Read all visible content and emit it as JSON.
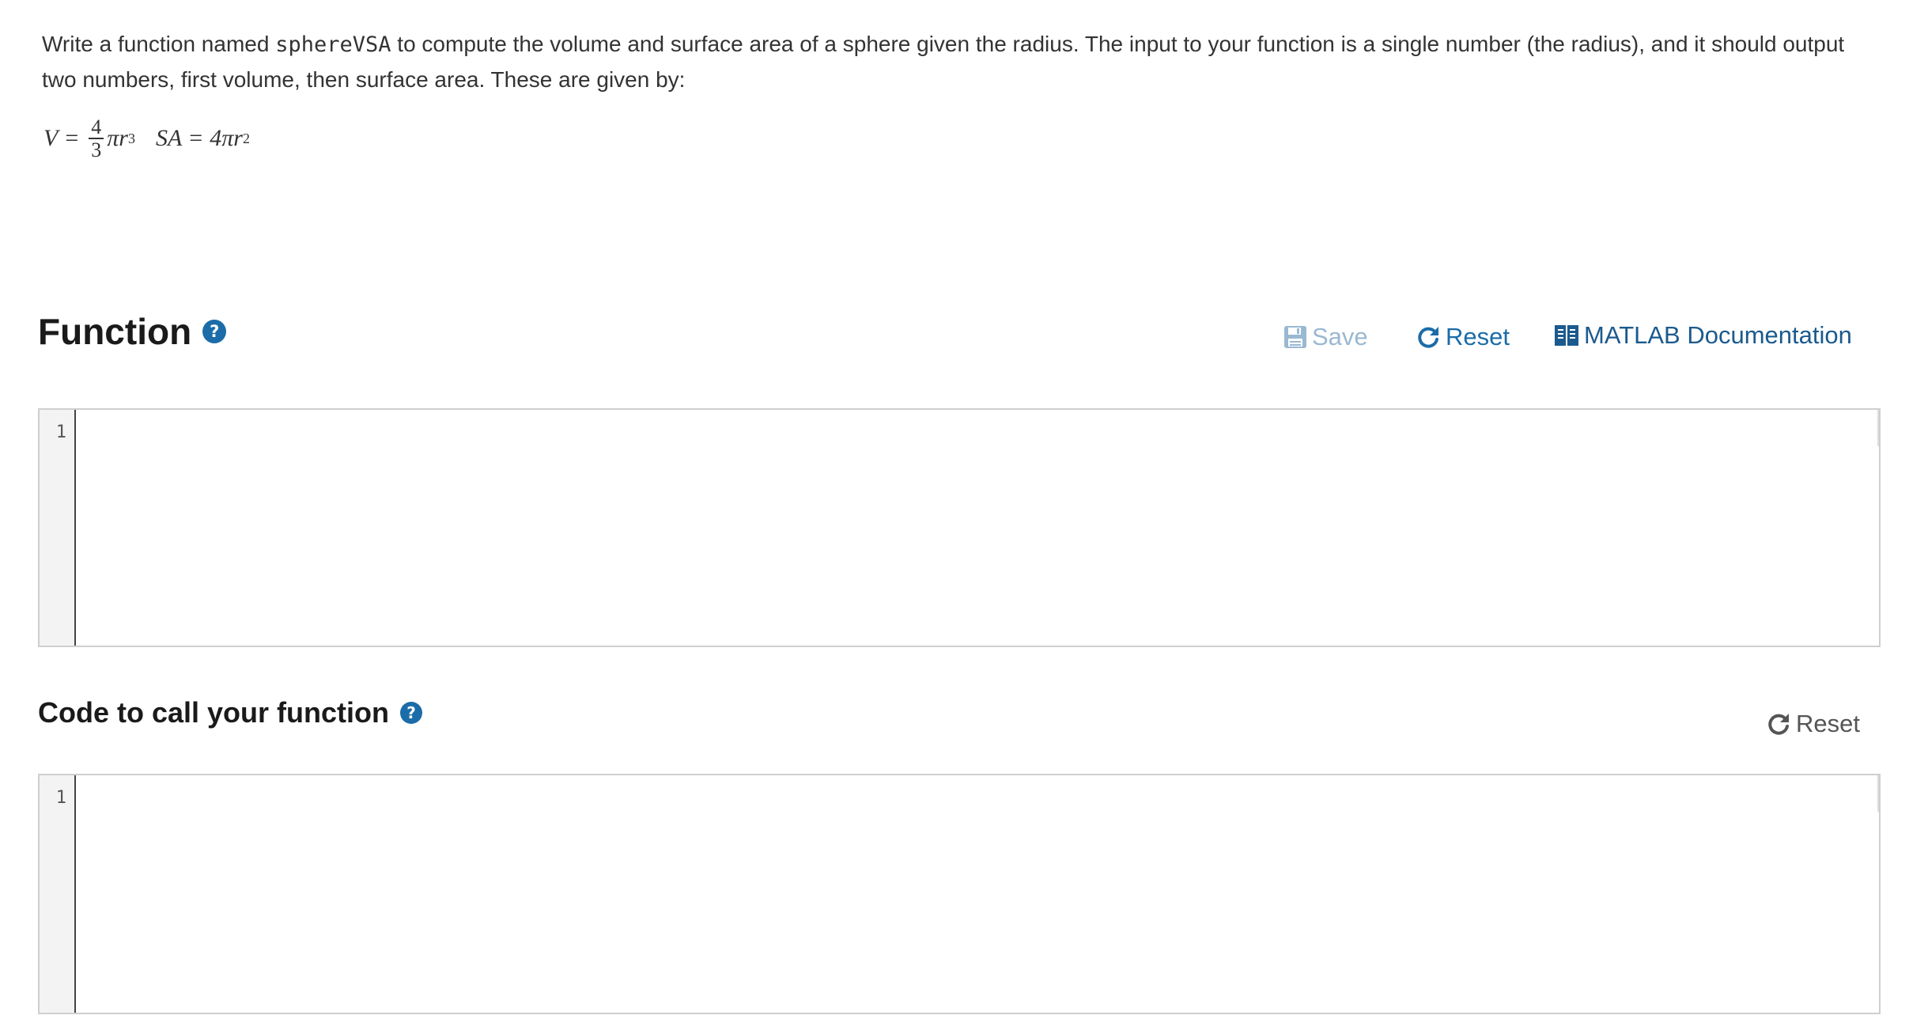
{
  "problem": {
    "text_before": "Write a function named ",
    "function_name": "sphereVSA",
    "text_after": " to compute the volume and surface area of a sphere given the radius.  The input to your function is a single number (the radius), and it should output two numbers, first volume, then surface area.  These are given by:"
  },
  "formula": {
    "v_var": "V",
    "eq": "=",
    "numerator": "4",
    "denominator": "3",
    "v_body": "πr",
    "v_exp": "3",
    "sa_var": "SA",
    "sa_body": "4πr",
    "sa_exp": "2"
  },
  "function_section": {
    "title": "Function",
    "help": "?",
    "save_label": "Save",
    "reset_label": "Reset",
    "doc_label": "MATLAB Documentation",
    "line_number": "1"
  },
  "call_section": {
    "title": "Code to call your function",
    "help": "?",
    "reset_label": "Reset",
    "line_number": "1"
  },
  "colors": {
    "accent": "#1b6ca8",
    "save_disabled": "#9ab8d2",
    "doc_link": "#1b5a8e"
  },
  "icons": {
    "save": "floppy-disk-icon",
    "reset": "rotate-icon",
    "documentation": "book-icon",
    "help": "question-circle-icon"
  }
}
